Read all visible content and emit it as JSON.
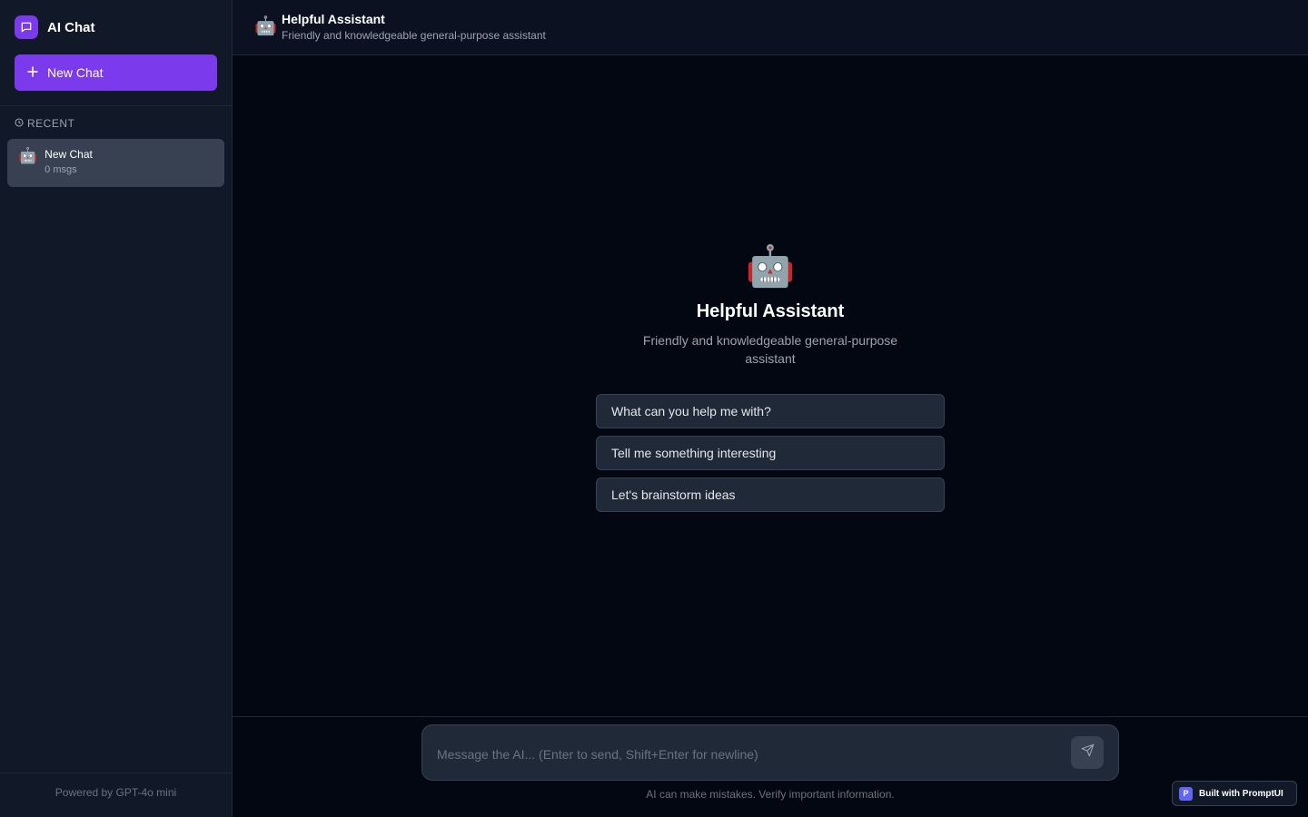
{
  "sidebar": {
    "brand": {
      "title": "AI Chat",
      "icon": "chat-bubble-icon"
    },
    "new_chat_label": "New Chat",
    "recent_label": "RECENT",
    "chats": [
      {
        "emoji": "🤖",
        "title": "New Chat",
        "meta": "0 msgs"
      }
    ],
    "footer": "Powered by GPT-4o mini"
  },
  "header": {
    "emoji": "🤖",
    "title": "Helpful Assistant",
    "subtitle": "Friendly and knowledgeable general-purpose assistant"
  },
  "welcome": {
    "emoji": "🤖",
    "title": "Helpful Assistant",
    "description": "Friendly and knowledgeable general-purpose assistant",
    "suggestions": [
      "What can you help me with?",
      "Tell me something interesting",
      "Let's brainstorm ideas"
    ]
  },
  "composer": {
    "placeholder": "Message the AI... (Enter to send, Shift+Enter for newline)",
    "send_icon": "send-icon"
  },
  "disclaimer": "AI can make mistakes. Verify important information.",
  "badge": {
    "logo_letter": "P",
    "text": "Built with PromptUI"
  },
  "colors": {
    "accent": "#7c3aed",
    "background": "#030712",
    "sidebar": "#111827",
    "surface": "#1f2937"
  }
}
